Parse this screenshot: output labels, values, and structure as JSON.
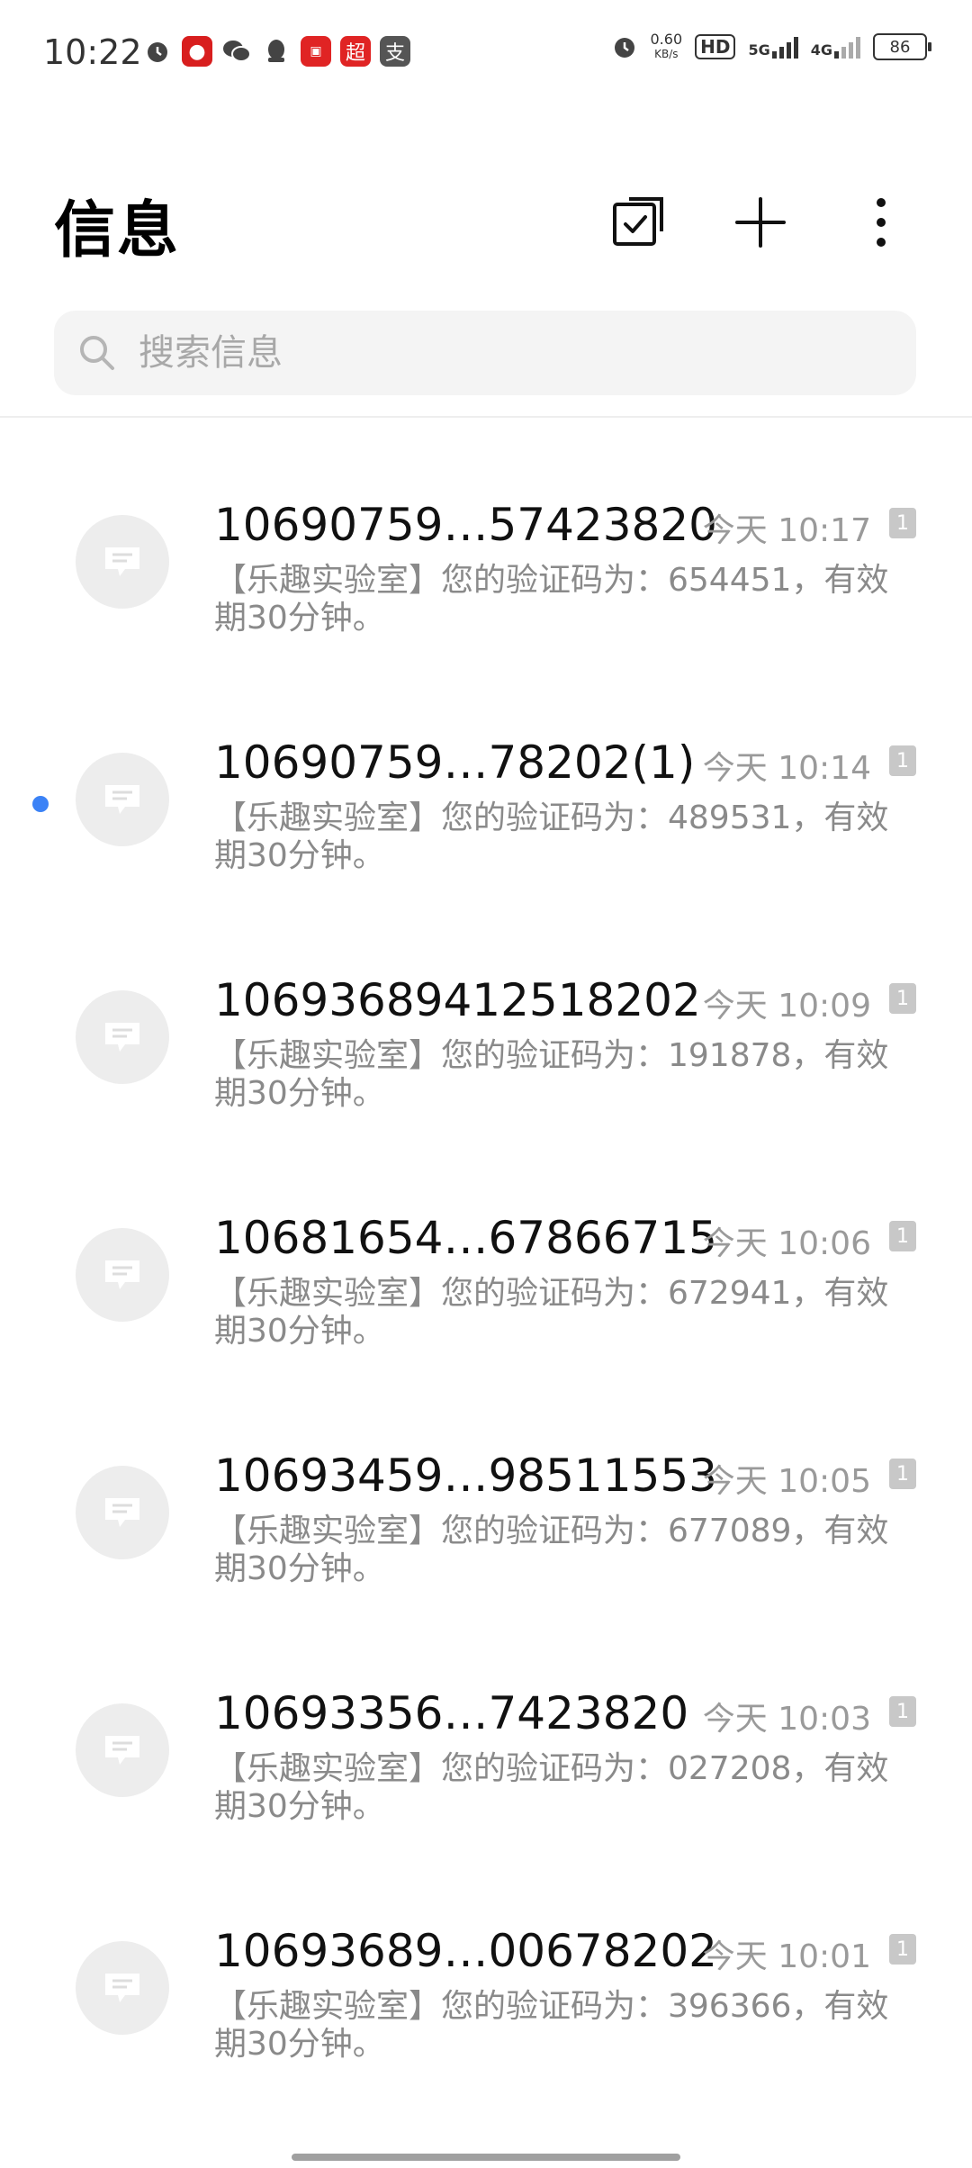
{
  "status": {
    "time": "10:22",
    "net_speed_value": "0.60",
    "net_speed_unit": "KB/s",
    "hd": "HD",
    "net1": "5G",
    "net2": "4G",
    "battery": "86"
  },
  "header": {
    "title": "信息"
  },
  "search": {
    "placeholder": "搜索信息"
  },
  "messages": [
    {
      "sender": "10690759…57423820",
      "time": "今天 10:17",
      "sim": "1",
      "preview": "【乐趣实验室】您的验证码为：654451，有效期30分钟。",
      "unread": false
    },
    {
      "sender": "10690759…78202(1)",
      "time": "今天 10:14",
      "sim": "1",
      "preview": "【乐趣实验室】您的验证码为：489531，有效期30分钟。",
      "unread": true
    },
    {
      "sender": "10693689412518202",
      "time": "今天 10:09",
      "sim": "1",
      "preview": "【乐趣实验室】您的验证码为：191878，有效期30分钟。",
      "unread": false
    },
    {
      "sender": "10681654…67866715",
      "time": "今天 10:06",
      "sim": "1",
      "preview": "【乐趣实验室】您的验证码为：672941，有效期30分钟。",
      "unread": false
    },
    {
      "sender": "10693459…98511553",
      "time": "今天 10:05",
      "sim": "1",
      "preview": "【乐趣实验室】您的验证码为：677089，有效期30分钟。",
      "unread": false
    },
    {
      "sender": "10693356…7423820",
      "time": "今天 10:03",
      "sim": "1",
      "preview": "【乐趣实验室】您的验证码为：027208，有效期30分钟。",
      "unread": false
    },
    {
      "sender": "10693689…00678202",
      "time": "今天 10:01",
      "sim": "1",
      "preview": "【乐趣实验室】您的验证码为：396366，有效期30分钟。",
      "unread": false
    }
  ]
}
